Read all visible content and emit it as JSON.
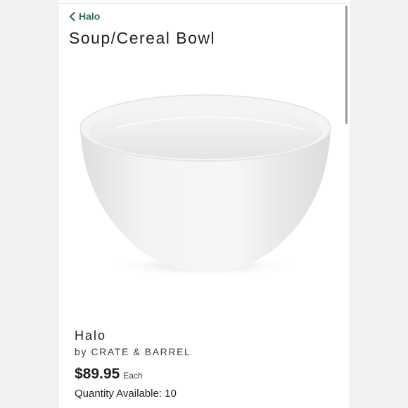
{
  "nav": {
    "back_label": "Halo"
  },
  "product": {
    "title": "Soup/Cereal Bowl",
    "pattern": "Halo",
    "maker": "by CRATE & BARREL",
    "price": "$89.95",
    "price_unit": "Each",
    "quantity_label": "Quantity Available: 10"
  },
  "colors": {
    "accent": "#2f6b57",
    "text": "#1f1f1f"
  },
  "icons": {
    "back": "chevron-left-icon"
  }
}
